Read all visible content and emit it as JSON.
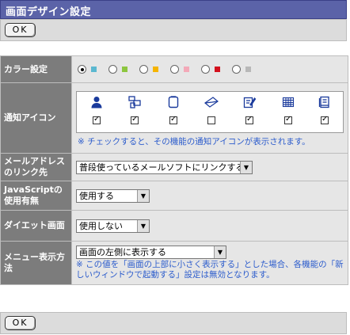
{
  "title": "画面デザイン設定",
  "ok_label": "OK",
  "rows": {
    "color": {
      "label": "カラー設定"
    },
    "notify": {
      "label": "通知アイコン",
      "note": "※ チェックすると、その機能の通知アイコンが表示されます。"
    },
    "mail": {
      "label": "メールアドレスのリンク先",
      "selected": "普段使っているメールソフトにリンクする"
    },
    "js": {
      "label": "JavaScriptの使用有無",
      "selected": "使用する"
    },
    "diet": {
      "label": "ダイエット画面",
      "selected": "使用しない"
    },
    "menu": {
      "label": "メニュー表示方法",
      "selected": "画面の左側に表示する",
      "note": "※ この値を「画面の上部に小さく表示する」とした場合、各機能の「新しいウィンドウで起動する」設定は無効となります。"
    }
  },
  "colors": [
    "#5bb8d0",
    "#8dc63f",
    "#f5b400",
    "#f3a9b8",
    "#d3101d",
    "#b8b8b8"
  ],
  "color_selected_index": 0,
  "notify_icons": [
    {
      "icon": "user-icon",
      "checked": true
    },
    {
      "icon": "group-icon",
      "checked": true
    },
    {
      "icon": "memo-icon",
      "checked": true
    },
    {
      "icon": "mail-icon",
      "checked": false
    },
    {
      "icon": "edit-icon",
      "checked": true
    },
    {
      "icon": "calendar-table-icon",
      "checked": true
    },
    {
      "icon": "document-icon",
      "checked": true
    }
  ]
}
